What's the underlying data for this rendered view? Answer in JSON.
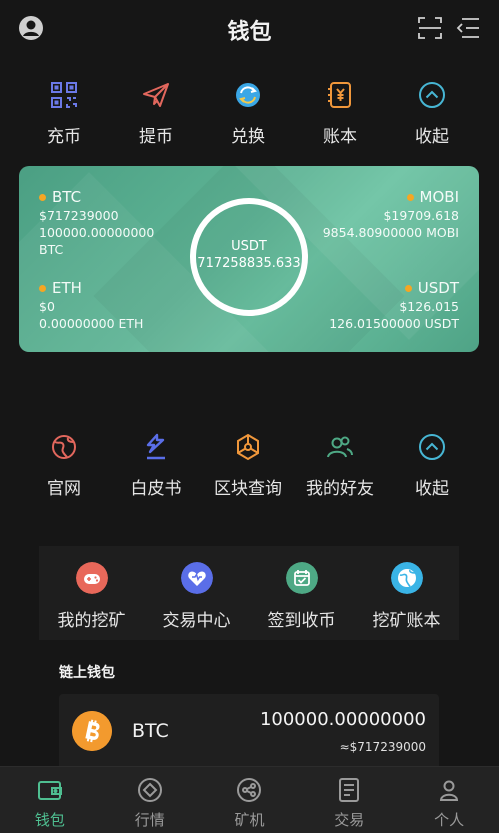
{
  "header": {
    "title": "钱包"
  },
  "actions_top": [
    {
      "label": "充币",
      "icon": "qr-code-icon"
    },
    {
      "label": "提币",
      "icon": "paper-plane-icon"
    },
    {
      "label": "兑换",
      "icon": "exchange-icon"
    },
    {
      "label": "账本",
      "icon": "ledger-icon"
    },
    {
      "label": "收起",
      "icon": "collapse-icon"
    }
  ],
  "balance_card": {
    "center": {
      "currency": "USDT",
      "total": "717258835.633"
    },
    "assets": [
      {
        "name": "BTC",
        "value": "$717239000",
        "amount": "100000.00000000",
        "unit": "BTC"
      },
      {
        "name": "MOBI",
        "value": "$19709.618",
        "amount": "9854.80900000 MOBI"
      },
      {
        "name": "ETH",
        "value": "$0",
        "amount": "0.00000000 ETH"
      },
      {
        "name": "USDT",
        "value": "$126.015",
        "amount": "126.01500000 USDT"
      }
    ]
  },
  "actions_mid": [
    {
      "label": "官网",
      "icon": "globe-icon"
    },
    {
      "label": "白皮书",
      "icon": "whitepaper-icon"
    },
    {
      "label": "区块查询",
      "icon": "blockchain-icon"
    },
    {
      "label": "我的好友",
      "icon": "friends-icon"
    },
    {
      "label": "收起",
      "icon": "collapse-icon"
    }
  ],
  "features": [
    {
      "label": "我的挖矿",
      "icon": "gamepad-icon",
      "color": "#e8685a"
    },
    {
      "label": "交易中心",
      "icon": "heart-icon",
      "color": "#5a6ee8"
    },
    {
      "label": "签到收币",
      "icon": "calendar-check-icon",
      "color": "#4ea985"
    },
    {
      "label": "挖矿账本",
      "icon": "globe-icon",
      "color": "#3ab4e6"
    }
  ],
  "chain_wallet": {
    "title": "链上钱包",
    "coins": [
      {
        "name": "BTC",
        "balance": "100000.00000000",
        "value": "≈$717239000",
        "icon": "bitcoin-icon",
        "color": "#f39a2e"
      }
    ]
  },
  "tabbar": [
    {
      "label": "钱包",
      "icon": "wallet-icon",
      "active": true
    },
    {
      "label": "行情",
      "icon": "market-icon",
      "active": false
    },
    {
      "label": "矿机",
      "icon": "miner-icon",
      "active": false
    },
    {
      "label": "交易",
      "icon": "trade-icon",
      "active": false
    },
    {
      "label": "个人",
      "icon": "person-icon",
      "active": false
    }
  ],
  "colors": {
    "accent": "#4fbf91",
    "card": "#5fb596",
    "background": "#161616",
    "dot": "#f5a623"
  }
}
